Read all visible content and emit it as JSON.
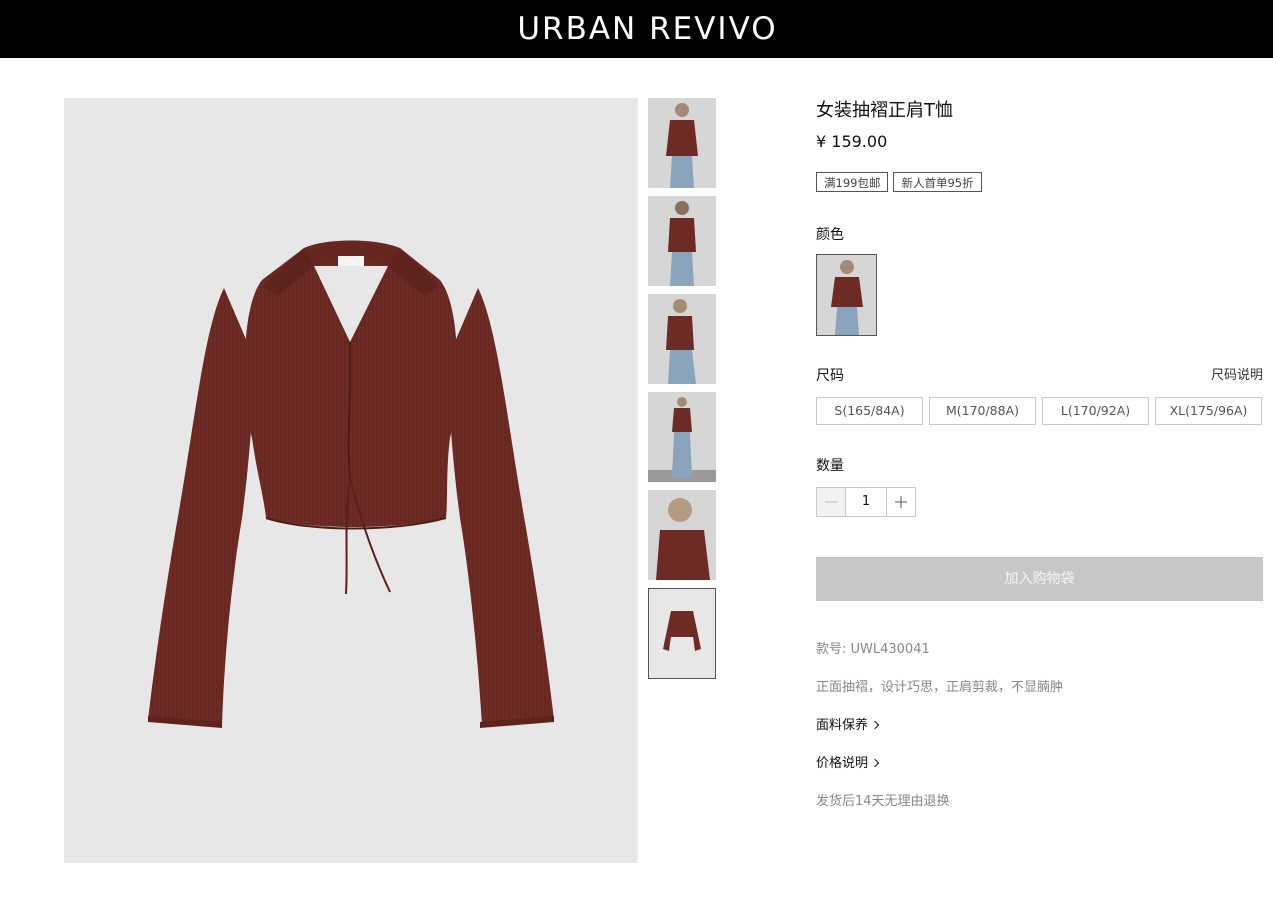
{
  "brand": {
    "logo_text": "URBAN REVIVO"
  },
  "product": {
    "title": "女装抽褶正肩T恤",
    "price": "¥ 159.00",
    "promotions": [
      "满199包邮",
      "新人首单95折"
    ],
    "garment_color": "#6e2a24",
    "image_background": "#e7e7e7"
  },
  "gallery": {
    "thumbnails": [
      {
        "icon": "model-front-view"
      },
      {
        "icon": "model-back-view"
      },
      {
        "icon": "model-side-view"
      },
      {
        "icon": "model-full-length-view"
      },
      {
        "icon": "model-closeup-view"
      },
      {
        "icon": "garment-flat-view",
        "active": true
      }
    ]
  },
  "color": {
    "label": "颜色",
    "selected_swatch_icon": "model-wearing-garment"
  },
  "size": {
    "label": "尺码",
    "guide_label": "尺码说明",
    "options": [
      "S(165/84A)",
      "M(170/88A)",
      "L(170/92A)",
      "XL(175/96A)"
    ]
  },
  "quantity": {
    "label": "数量",
    "value": "1"
  },
  "actions": {
    "add_to_bag": "加入购物袋"
  },
  "details": {
    "sku": "款号: UWL430041",
    "description": "正面抽褶，设计巧思，正肩剪裁，不显腩肿",
    "fabric_care": "面料保养",
    "price_info": "价格说明",
    "return_policy": "发货后14天无理由退换"
  }
}
